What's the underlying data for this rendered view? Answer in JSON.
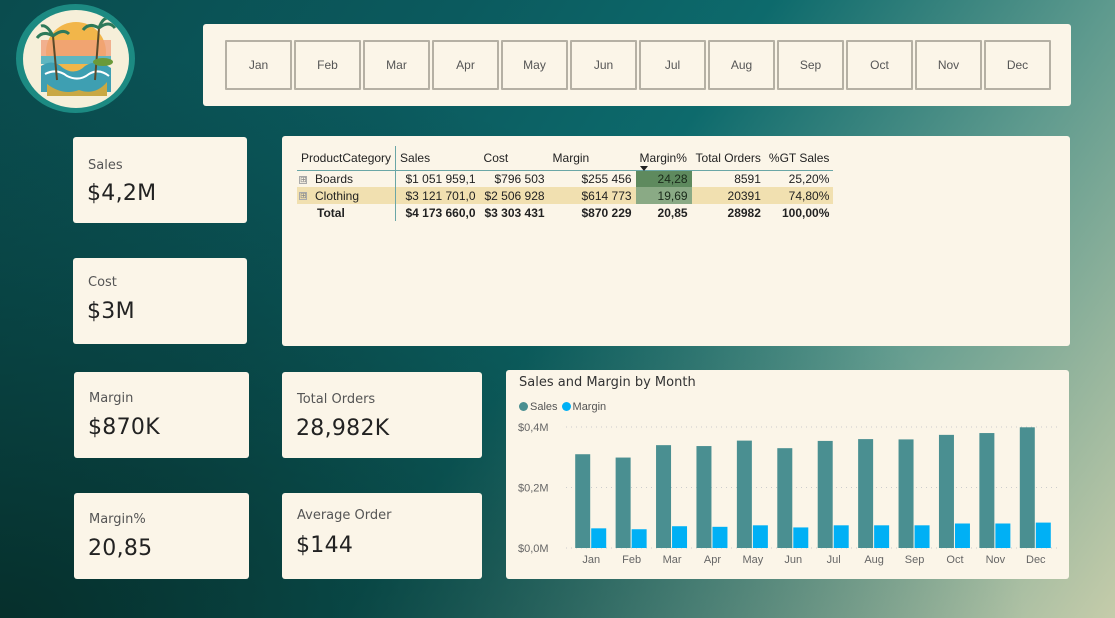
{
  "logo": {
    "name": "tropical-beach-logo"
  },
  "slicer": {
    "months": [
      "Jan",
      "Feb",
      "Mar",
      "Apr",
      "May",
      "Jun",
      "Jul",
      "Aug",
      "Sep",
      "Oct",
      "Nov",
      "Dec"
    ]
  },
  "kpis": {
    "sales": {
      "label": "Sales",
      "value": "$4,2M"
    },
    "cost": {
      "label": "Cost",
      "value": "$3M"
    },
    "margin": {
      "label": "Margin",
      "value": "$870K"
    },
    "margin_pct": {
      "label": "Margin%",
      "value": "20,85"
    },
    "total_orders": {
      "label": "Total Orders",
      "value": "28,982K"
    },
    "average_order": {
      "label": "Average Order",
      "value": "$144"
    }
  },
  "matrix": {
    "headers": [
      "ProductCategory",
      "Sales",
      "Cost",
      "Margin",
      "Margin%",
      "Total Orders",
      "%GT Sales"
    ],
    "rows": [
      {
        "category": "Boards",
        "sales": "$1 051 959,1",
        "cost": "$796 503",
        "margin": "$255 456",
        "margin_pct": "24,28",
        "orders": "8591",
        "gt_sales": "25,20%",
        "heat": "#5e8a5e"
      },
      {
        "category": "Clothing",
        "sales": "$3 121 701,0",
        "cost": "$2 506 928",
        "margin": "$614 773",
        "margin_pct": "19,69",
        "orders": "20391",
        "gt_sales": "74,80%",
        "heat": "#8aaa85"
      }
    ],
    "total": {
      "label": "Total",
      "sales": "$4 173 660,0",
      "cost": "$3 303 431",
      "margin": "$870 229",
      "margin_pct": "20,85",
      "orders": "28982",
      "gt_sales": "100,00%"
    },
    "expand_symbol": "⊞"
  },
  "chart_data": {
    "type": "bar",
    "title": "Sales and Margin by Month",
    "categories": [
      "Jan",
      "Feb",
      "Mar",
      "Apr",
      "May",
      "Jun",
      "Jul",
      "Aug",
      "Sep",
      "Oct",
      "Nov",
      "Dec"
    ],
    "series": [
      {
        "name": "Sales",
        "color": "#4a8f91",
        "values": [
          0.31,
          0.299,
          0.34,
          0.337,
          0.355,
          0.33,
          0.354,
          0.36,
          0.359,
          0.374,
          0.38,
          0.399
        ]
      },
      {
        "name": "Margin",
        "color": "#00b0f5",
        "values": [
          0.065,
          0.062,
          0.072,
          0.07,
          0.075,
          0.068,
          0.075,
          0.075,
          0.075,
          0.081,
          0.081,
          0.084
        ]
      }
    ],
    "yticks": [
      {
        "value": 0.0,
        "label": "$0,0M"
      },
      {
        "value": 0.2,
        "label": "$0,2M"
      },
      {
        "value": 0.4,
        "label": "$0,4M"
      }
    ],
    "ylim": [
      0,
      0.4
    ],
    "unit": "$M",
    "xlabel": "",
    "ylabel": "",
    "legend": "top-left",
    "grid": true
  }
}
